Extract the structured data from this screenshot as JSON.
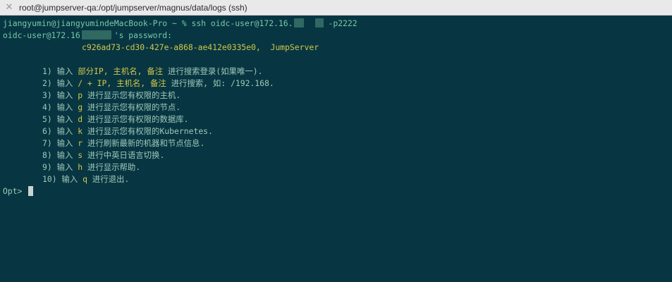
{
  "window": {
    "title": "root@jumpserver-qa:/opt/jumpserver/magnus/data/logs (ssh)"
  },
  "terminal": {
    "cmd_user": "jiangyumin@jiangyumindeMacBook-Pro",
    "cmd_sep": " ~ % ",
    "cmd_ssh": "ssh oidc-user@172.16.",
    "cmd_port": "-p2222",
    "pw_user": "oidc-user@172.16",
    "pw_suffix": "'s password:",
    "session_id": "c926ad73-cd30-427e-a868-ae412e0335e0,",
    "server_name": "JumpServer",
    "menu": [
      {
        "num": "1) 输入 ",
        "key": "部分IP, 主机名, 备注",
        "desc": " 进行搜索登录(如果唯一)."
      },
      {
        "num": "2) 输入 ",
        "key": "/ + IP, 主机名, 备注",
        "desc": " 进行搜索, 如: /192.168."
      },
      {
        "num": "3) 输入 ",
        "key": "p",
        "desc": " 进行显示您有权限的主机."
      },
      {
        "num": "4) 输入 ",
        "key": "g",
        "desc": " 进行显示您有权限的节点."
      },
      {
        "num": "5) 输入 ",
        "key": "d",
        "desc": " 进行显示您有权限的数据库."
      },
      {
        "num": "6) 输入 ",
        "key": "k",
        "desc": " 进行显示您有权限的Kubernetes."
      },
      {
        "num": "7) 输入 ",
        "key": "r",
        "desc": " 进行刷新最新的机器和节点信息."
      },
      {
        "num": "8) 输入 ",
        "key": "s",
        "desc": " 进行中英日语言切换."
      },
      {
        "num": "9) 输入 ",
        "key": "h",
        "desc": " 进行显示帮助."
      },
      {
        "num": "10) 输入 ",
        "key": "q",
        "desc": " 进行退出."
      }
    ],
    "prompt": "Opt> "
  }
}
